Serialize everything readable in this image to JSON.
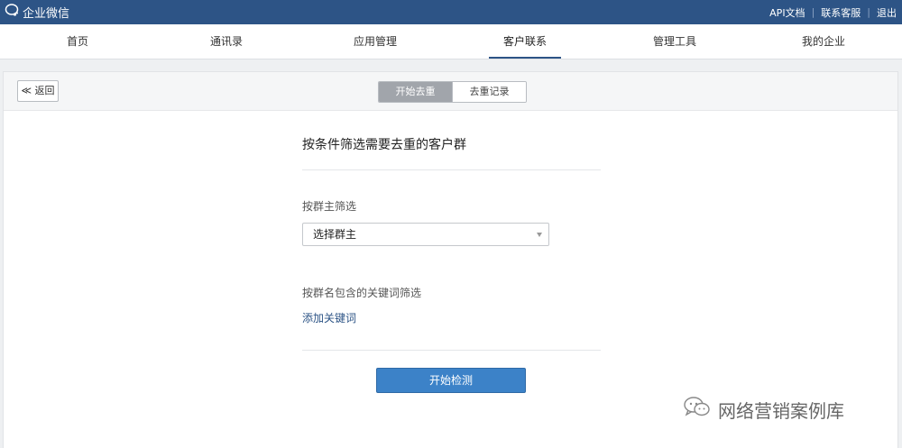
{
  "app": {
    "name": "企业微信",
    "logo_icon": "chat-bubble-icon"
  },
  "top_links": {
    "api_docs": "API文档",
    "support": "联系客服",
    "logout": "退出"
  },
  "nav": {
    "items": [
      "首页",
      "通讯录",
      "应用管理",
      "客户联系",
      "管理工具",
      "我的企业"
    ],
    "active": "客户联系"
  },
  "toolbar": {
    "back_label": "≪ 返回",
    "tabs": [
      "开始去重",
      "去重记录"
    ],
    "active_tab": "开始去重"
  },
  "form": {
    "title": "按条件筛选需要去重的客户群",
    "owner_filter_label": "按群主筛选",
    "owner_select_value": "选择群主",
    "keyword_filter_label": "按群名包含的关键词筛选",
    "add_keyword_link": "添加关键词",
    "start_button": "开始检测"
  },
  "watermark": {
    "text": "网络营销案例库",
    "icon": "wechat-icon"
  },
  "colors": {
    "topbar": "#2d5486",
    "primary_button": "#3c82c8",
    "link": "#2d5486",
    "active_tab": "#a1a5ab"
  }
}
